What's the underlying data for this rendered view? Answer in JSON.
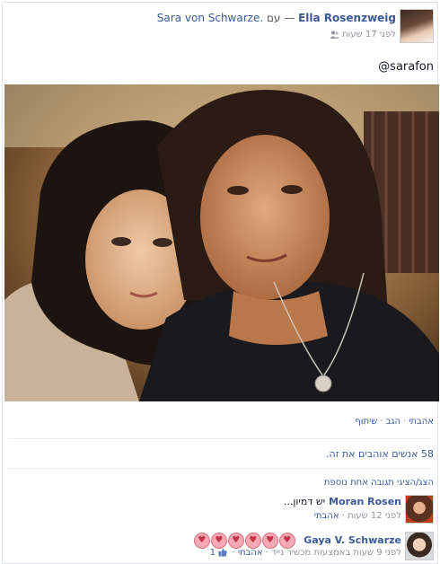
{
  "post": {
    "author": "Ella Rosenzweig",
    "with_sep": " — עם ",
    "tagged": "Sara von Schwarze.",
    "time": "לפני 17 שעות",
    "audience_icon": "friends-icon",
    "caption": "@sarafon"
  },
  "actions": {
    "like": "אהבתי",
    "comment": "הגב",
    "share": "שיתוף",
    "sep": "·"
  },
  "likes": {
    "text": "58 אנשים אוהבים את זה."
  },
  "more_comments": "הצג/הציגי תגובה אחת נוספת",
  "comments": [
    {
      "name": "Moran Rosen",
      "text": "יש דמיון...",
      "time": "לפני 12 שעות",
      "like": "אהבתי"
    },
    {
      "name": "Gaya V. Schwarze",
      "hearts": [
        "♥",
        "♥",
        "♥",
        "♥",
        "♥",
        "♥"
      ],
      "time": "לפני 9 שעות באמצעות מכשיר נייד",
      "like": "אהבתי",
      "like_count": "1"
    }
  ],
  "colors": {
    "link": "#3b5998",
    "muted": "#90949c",
    "border": "#dfe3ee"
  }
}
